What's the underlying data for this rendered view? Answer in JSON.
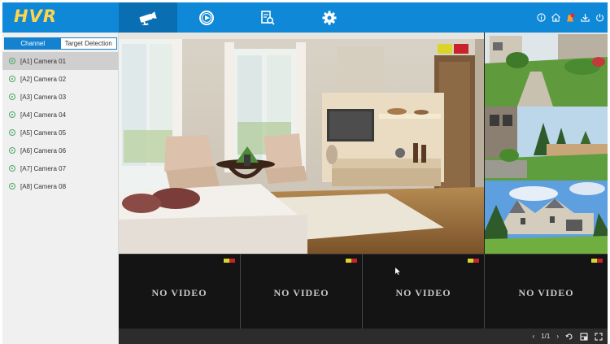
{
  "app": {
    "logo": "HVR",
    "brand_color": "#0f88d8",
    "logo_color": "#ffd54a"
  },
  "nav": {
    "tabs": [
      {
        "icon": "camera-icon",
        "active": true
      },
      {
        "icon": "playback-icon",
        "active": false
      },
      {
        "icon": "search-file-icon",
        "active": false
      },
      {
        "icon": "settings-gear-icon",
        "active": false
      }
    ],
    "right_icons": [
      "info-icon",
      "home-icon",
      "alarm-notification-icon",
      "download-icon",
      "power-icon"
    ]
  },
  "sidebar": {
    "tabs": {
      "channel": "Channel",
      "target_detection": "Target Detection"
    },
    "cameras": [
      {
        "label": "[A1] Camera 01",
        "selected": true
      },
      {
        "label": "[A2] Camera 02"
      },
      {
        "label": "[A3] Camera 03"
      },
      {
        "label": "[A4] Camera 04"
      },
      {
        "label": "[A5] Camera 05"
      },
      {
        "label": "[A6] Camera 06"
      },
      {
        "label": "[A7] Camera 07"
      },
      {
        "label": "[A8] Camera 08"
      }
    ]
  },
  "tiles": [
    {
      "status": "NO VIDEO"
    },
    {
      "status": "NO VIDEO"
    },
    {
      "status": "NO VIDEO"
    },
    {
      "status": "NO VIDEO"
    }
  ],
  "pager": {
    "page": "1/1"
  }
}
